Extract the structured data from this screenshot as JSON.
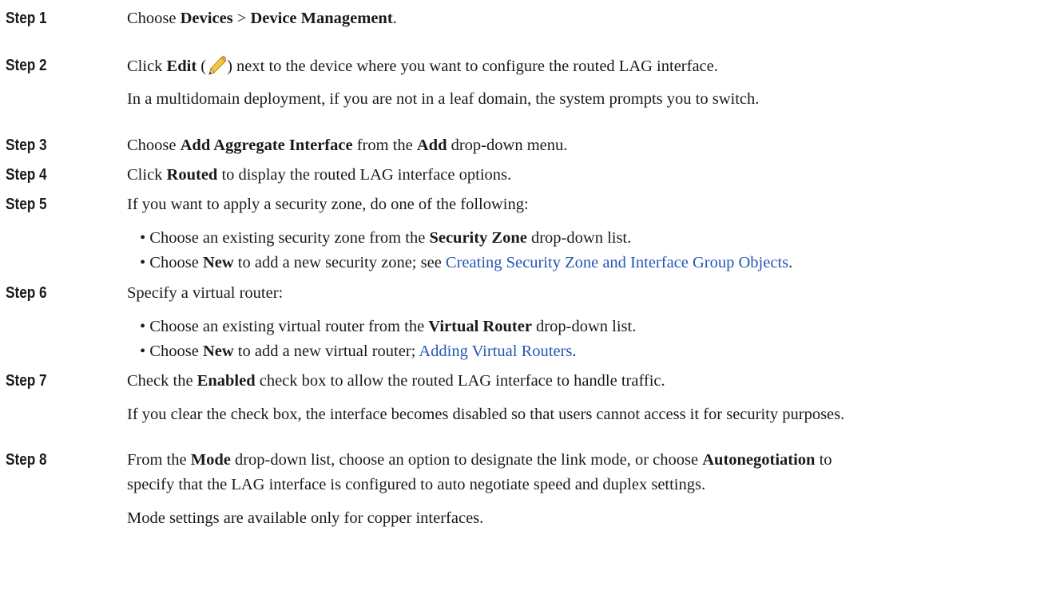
{
  "steps": [
    {
      "label": "Step 1",
      "main": {
        "a": "Choose ",
        "b1": "Devices",
        "c": " > ",
        "b2": "Device Management",
        "d": "."
      }
    },
    {
      "label": "Step 2",
      "main": {
        "a": "Click ",
        "b": "Edit",
        "c": " (",
        "d": ") next to the device where you want to configure the routed LAG interface."
      },
      "note": "In a multidomain deployment, if you are not in a leaf domain, the system prompts you to switch."
    },
    {
      "label": "Step 3",
      "main": {
        "a": "Choose ",
        "b1": "Add Aggregate Interface",
        "c": " from the ",
        "b2": "Add",
        "d": " drop-down menu."
      }
    },
    {
      "label": "Step 4",
      "main": {
        "a": "Click ",
        "b": "Routed",
        "c": " to display the routed LAG interface options."
      }
    },
    {
      "label": "Step 5",
      "main": "If you want to apply a security zone, do one of the following:",
      "bullets": [
        {
          "a": "• Choose an existing security zone from the ",
          "b": "Security Zone",
          "c": " drop-down list."
        },
        {
          "a": "• Choose ",
          "b": "New",
          "c": " to add a new security zone; see ",
          "link": "Creating Security Zone and Interface Group Objects",
          "d": "."
        }
      ]
    },
    {
      "label": "Step 6",
      "main": "Specify a virtual router:",
      "bullets": [
        {
          "a": "• Choose an existing virtual router from the ",
          "b": "Virtual Router",
          "c": " drop-down list."
        },
        {
          "a": "• Choose ",
          "b": "New",
          "c": " to add a new virtual router; ",
          "link": "Adding Virtual Routers",
          "d": "."
        }
      ]
    },
    {
      "label": "Step 7",
      "main": {
        "a": "Check the ",
        "b": "Enabled",
        "c": " check box to allow the routed LAG interface to handle traffic."
      },
      "note": "If you clear the check box, the interface becomes disabled so that users cannot access it for security purposes."
    },
    {
      "label": "Step 8",
      "main": {
        "a": "From the ",
        "b1": "Mode",
        "c": " drop-down list, choose an option to designate the link mode, or choose ",
        "b2": "Autonegotiation",
        "d": " to"
      },
      "main2": "specify that the LAG interface is configured to auto negotiate speed and duplex settings.",
      "note": "Mode settings are available only for copper interfaces."
    }
  ],
  "icons": {
    "edit": "pencil-icon"
  },
  "colors": {
    "link": "#2456b3",
    "text": "#1a1a1a"
  }
}
